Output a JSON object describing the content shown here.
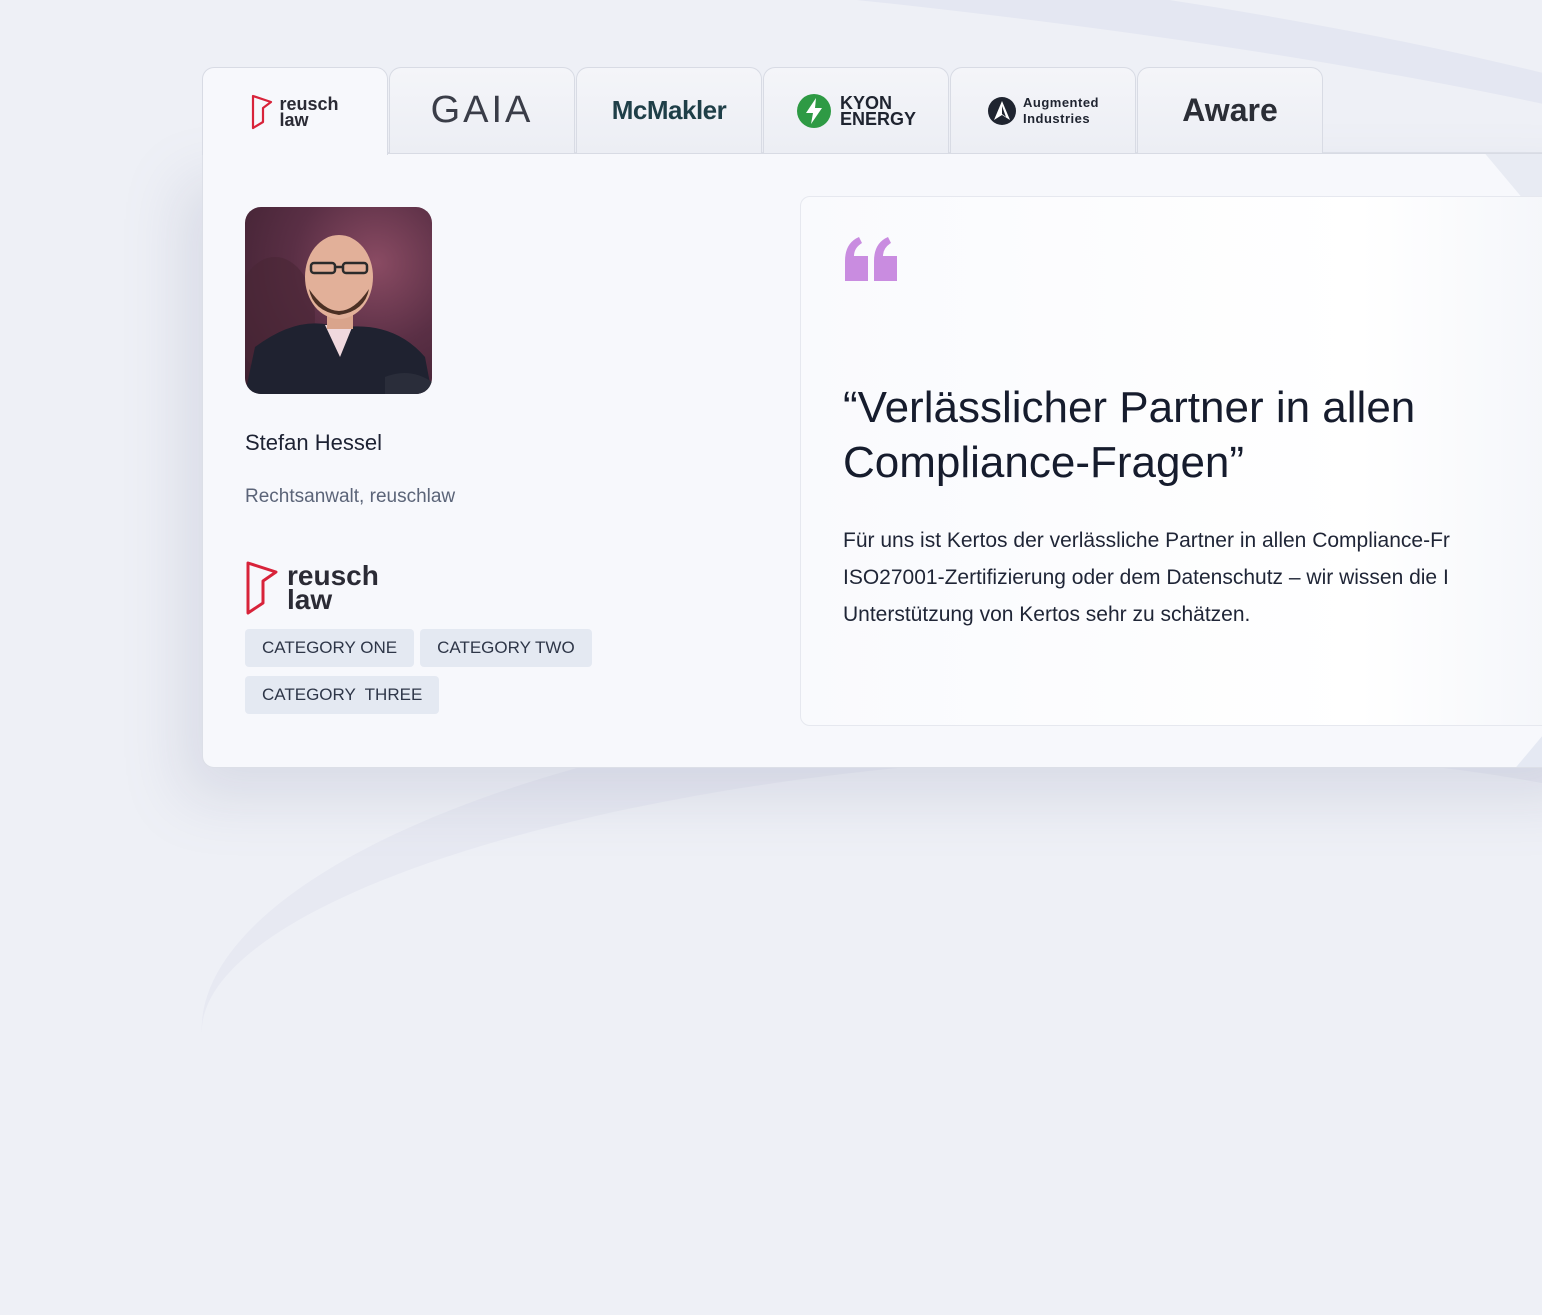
{
  "tabs": [
    {
      "id": "reusch",
      "line1": "reusch",
      "line2": "law"
    },
    {
      "id": "gaia",
      "label": "GAIA"
    },
    {
      "id": "mcmakler",
      "label": "McMakler"
    },
    {
      "id": "kyon",
      "line1": "KYON",
      "line2": "ENERGY"
    },
    {
      "id": "augmented",
      "line1": "Augmented",
      "line2": "Industries"
    },
    {
      "id": "aware",
      "label": "Aware"
    }
  ],
  "active_tab": "reusch",
  "testimonial": {
    "name": "Stefan Hessel",
    "role": "Rechtsanwalt, reuschlaw",
    "company_logo": {
      "line1": "reusch",
      "line2": "law"
    },
    "categories": [
      "CATEGORY ONE",
      "CATEGORY TWO",
      "CATEGORY  THREE"
    ],
    "quote_title": "“Verlässlicher Partner in allen Compliance-Fragen”",
    "quote_body_lines": [
      "Für uns ist Kertos der verlässliche Partner in allen Compliance-Fr",
      "ISO27001-Zertifizierung oder dem Datenschutz – wir wissen die I",
      "Unterstützung von Kertos sehr zu schätzen."
    ]
  },
  "colors": {
    "accent_quote": "#c98ce0",
    "reusch_red": "#d8233a",
    "kyon_green": "#2e9a44"
  },
  "icons": [
    "quote-icon",
    "reusch-logo-icon",
    "kyon-bolt-icon",
    "augmented-logo-icon",
    "avatar-photo"
  ]
}
